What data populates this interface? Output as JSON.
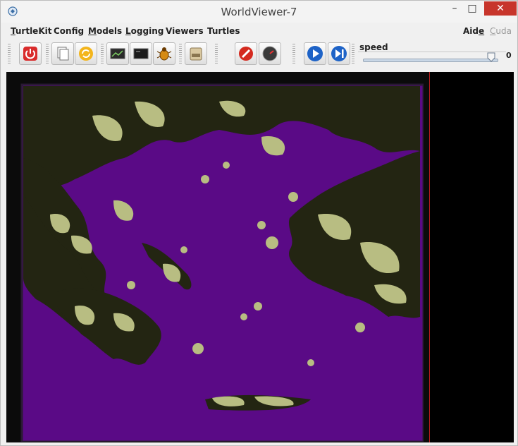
{
  "window": {
    "title": "WorldViewer-7",
    "controls": {
      "minimize": "–",
      "maximize": "□",
      "close": "✕"
    }
  },
  "menubar": {
    "items": [
      {
        "label": "TurtleKit",
        "mnemonic": "T"
      },
      {
        "label": "Config",
        "mnemonic": ""
      },
      {
        "label": "Models",
        "mnemonic": "M"
      },
      {
        "label": "Logging",
        "mnemonic": "L"
      },
      {
        "label": "Viewers",
        "mnemonic": ""
      },
      {
        "label": "Turtles",
        "mnemonic": ""
      }
    ],
    "right_items": [
      {
        "label": "Aide",
        "mnemonic": "e",
        "enabled": true
      },
      {
        "label": "Cuda",
        "mnemonic": "C",
        "enabled": false
      }
    ]
  },
  "toolbar": {
    "buttons": [
      {
        "icon": "power-icon"
      },
      {
        "icon": "copy-icon"
      },
      {
        "icon": "reload-icon"
      },
      {
        "icon": "monitor-icon"
      },
      {
        "icon": "console-icon"
      },
      {
        "icon": "bug-icon"
      },
      {
        "icon": "jar-icon"
      },
      {
        "icon": "stop-icon"
      },
      {
        "icon": "gauge-icon"
      },
      {
        "icon": "play-icon"
      },
      {
        "icon": "step-icon"
      }
    ],
    "speed": {
      "label": "speed",
      "value": "0",
      "level": 0.95
    }
  },
  "colors": {
    "sea": "#5a0a86",
    "land_dark": "#232512",
    "land_light": "#b8bd82",
    "right_pane": "#000000",
    "divider": "#b71c1c",
    "close_button": "#c7352b"
  }
}
